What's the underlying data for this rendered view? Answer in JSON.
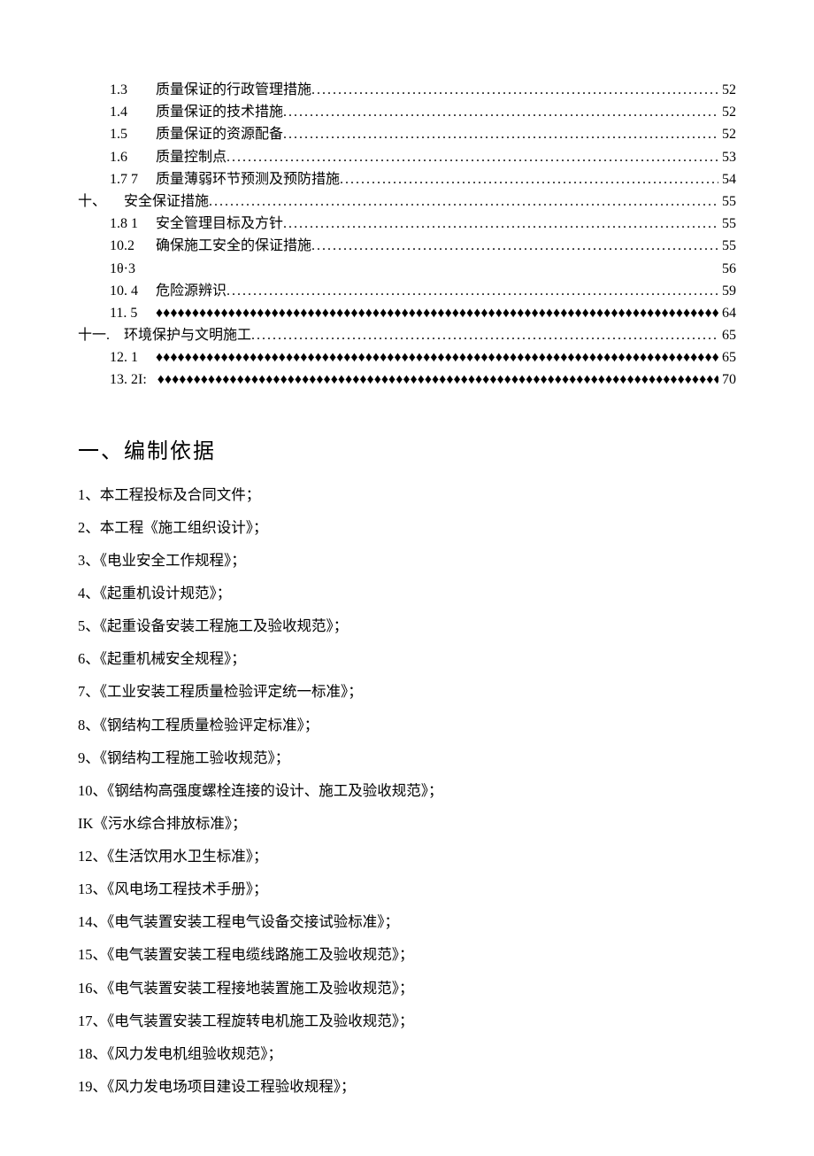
{
  "toc": [
    {
      "indent": "indent2",
      "num": "1.3",
      "title": "质量保证的行政管理措施",
      "leader": "dots",
      "page": "52"
    },
    {
      "indent": "indent2",
      "num": "1.4",
      "title": "质量保证的技术措施",
      "leader": "dots",
      "page": "52"
    },
    {
      "indent": "indent2",
      "num": "1.5",
      "title": "质量保证的资源配备",
      "leader": "dots",
      "page": "52"
    },
    {
      "indent": "indent2",
      "num": "1.6",
      "title": "质量控制点",
      "leader": "dots",
      "page": "53"
    },
    {
      "indent": "indent2",
      "num": "1.7 7",
      "title": "质量薄弱环节预测及预防措施",
      "leader": "dots",
      "page": "54"
    },
    {
      "indent": "indent0",
      "num": "十、",
      "title": "安全保证措施",
      "leader": "dots",
      "page": "55"
    },
    {
      "indent": "indent2",
      "num": "1.8 1",
      "title": "安全管理目标及方针",
      "leader": "dots",
      "page": "55"
    },
    {
      "indent": "indent2",
      "num": "10.2",
      "title": "确保施工安全的保证措施",
      "leader": "dots",
      "page": "55"
    },
    {
      "indent": "indent2",
      "num": "1θ·3",
      "title": "",
      "leader": "blank",
      "page": "56"
    },
    {
      "indent": "indent2",
      "num": "10. 4",
      "title": "危险源辨识",
      "leader": "dots",
      "page": "59"
    },
    {
      "indent": "indent2",
      "num": "11. 5",
      "title": "",
      "leader": "diamonds",
      "page": "64"
    },
    {
      "indent": "indent0",
      "num": "十一.",
      "title": "环境保护与文明施工",
      "leader": "dots",
      "page": "65"
    },
    {
      "indent": "indent2",
      "num": "12. 1",
      "title": "",
      "leader": "diamonds",
      "page": "65"
    },
    {
      "indent": "indent2",
      "num": "13. 2I:",
      "title": "",
      "leader": "diamonds",
      "page": "70"
    }
  ],
  "heading": "一、编制依据",
  "items": [
    "1、本工程投标及合同文件；",
    "2、本工程《施工组织设计》；",
    "3、《电业安全工作规程》；",
    "4、《起重机设计规范》；",
    "5、《起重设备安装工程施工及验收规范》；",
    "6、《起重机械安全规程》；",
    "7、《工业安装工程质量检验评定统一标准》；",
    "8、《钢结构工程质量检验评定标准》；",
    "9、《钢结构工程施工验收规范》；",
    "10、《钢结构高强度螺栓连接的设计、施工及验收规范》；",
    "IK《污水综合排放标准》；",
    "12、《生活饮用水卫生标准》；",
    "13、《风电场工程技术手册》；",
    "14、《电气装置安装工程电气设备交接试验标准》；",
    "15、《电气装置安装工程电缆线路施工及验收规范》；",
    "16、《电气装置安装工程接地装置施工及验收规范》；",
    "17、《电气装置安装工程旋转电机施工及验收规范》；",
    "18、《风力发电机组验收规范》；",
    "19、《风力发电场项目建设工程验收规程》；"
  ]
}
